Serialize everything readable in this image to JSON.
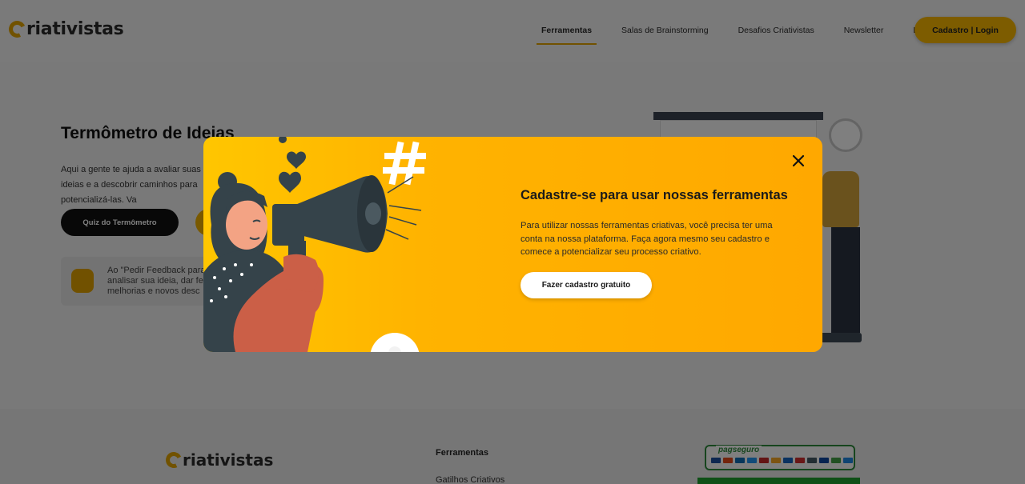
{
  "header": {
    "logo_text": "riativistas",
    "nav": [
      {
        "label": "Ferramentas",
        "active": true
      },
      {
        "label": "Salas de Brainstorming",
        "active": false
      },
      {
        "label": "Desafios Criativistas",
        "active": false
      },
      {
        "label": "Newsletter",
        "active": false
      },
      {
        "label": "Loja",
        "active": false
      }
    ],
    "cta_label": "Cadastro | Login"
  },
  "hero": {
    "title": "Termômetro de Ideias",
    "text": "Aqui a gente te ajuda a avaliar suas ideias e a descobrir caminhos para potencializá-las. Va",
    "quiz_button": "Quiz do Termômetro",
    "feedback_text": "Ao \"Pedir Feedback para analisar sua ideia, dar fe melhorias e novos desc"
  },
  "modal": {
    "title": "Cadastre-se para usar nossas ferramentas",
    "text": "Para utilizar nossas ferramentas criativas, você precisa ter uma conta na nossa plataforma. Faça agora mesmo seu cadastro e comece a potencializar seu processo criativo.",
    "button": "Fazer cadastro gratuito",
    "close_icon": "close-icon"
  },
  "footer": {
    "logo_text": "riativistas",
    "heading": "Ferramentas",
    "link": "Gatilhos Criativos",
    "payment_badge": "pagseguro"
  },
  "colors": {
    "accent": "#fbb900",
    "modal_start": "#ffc600",
    "modal_end": "#ffa800",
    "overlay": "rgba(0,0,0,0.5)"
  }
}
